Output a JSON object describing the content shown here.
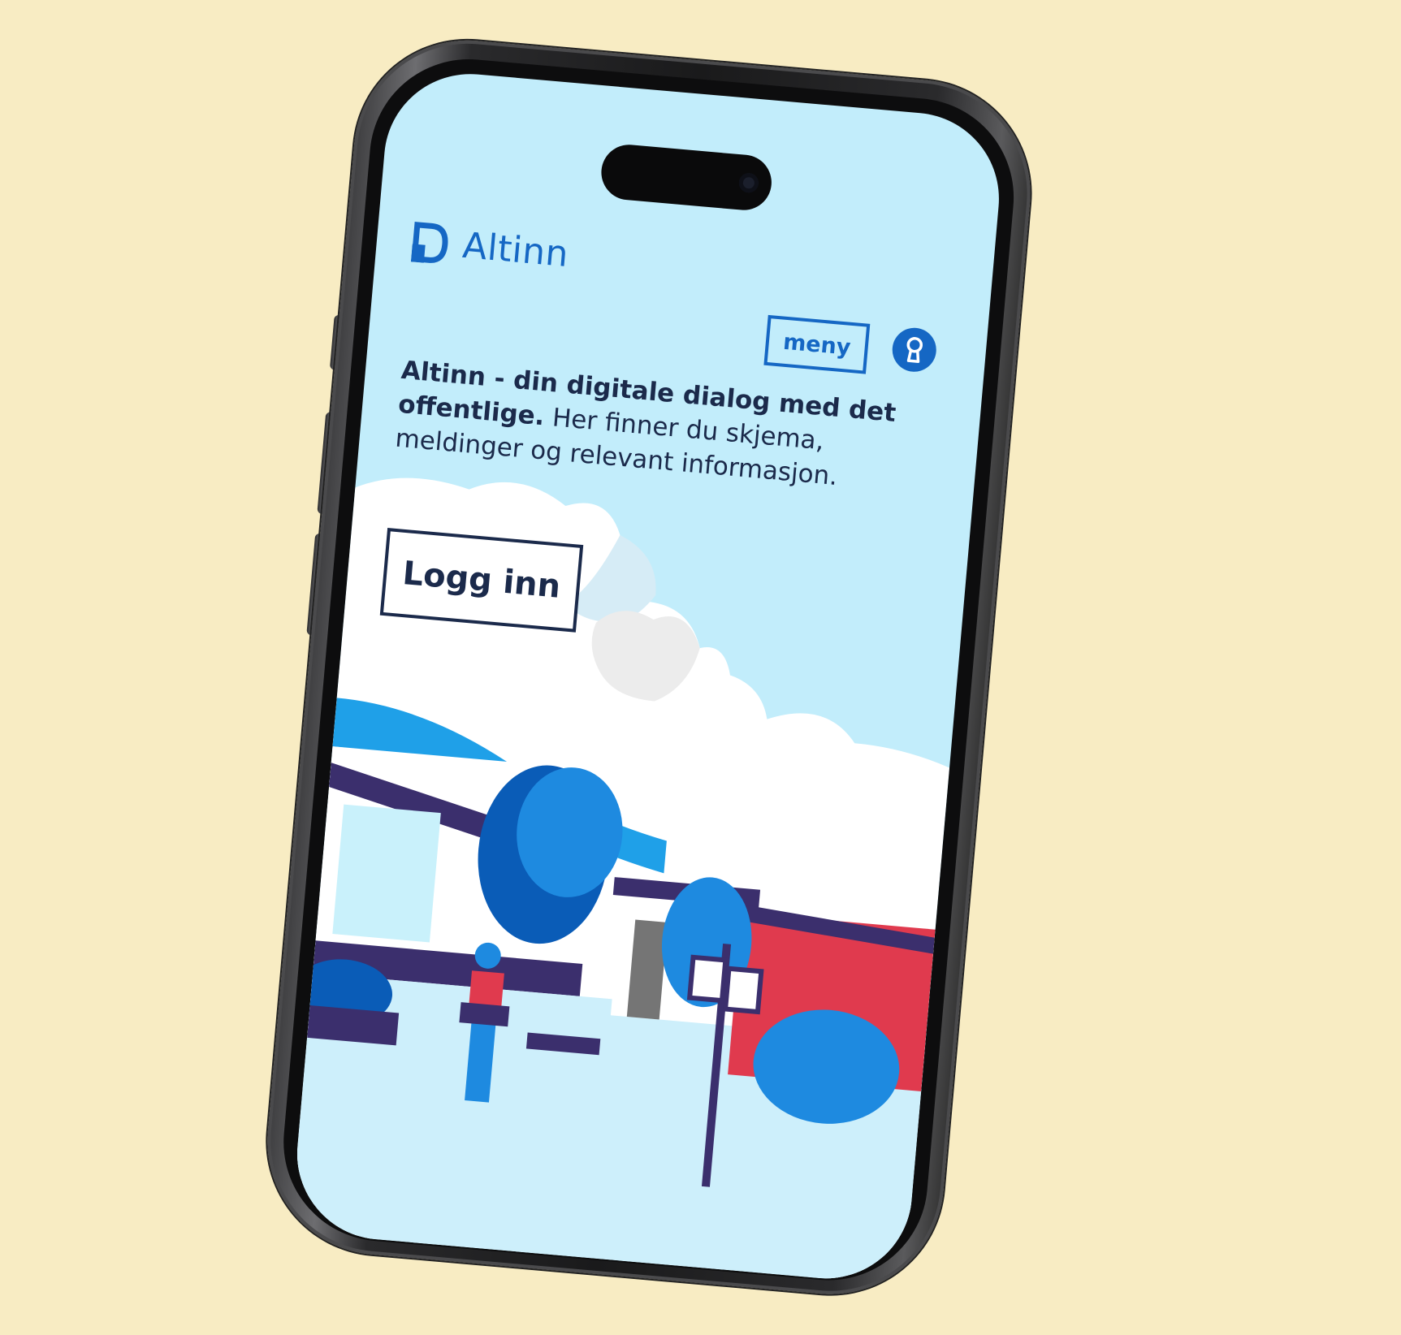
{
  "brand": {
    "name": "Altinn"
  },
  "header": {
    "menu_label": "meny",
    "login_icon": "keyhole-icon"
  },
  "intro": {
    "bold": "Altinn - din digitale dialog med det offentlige.",
    "rest": " Her finner du skjema, meldinger og relevant informasjon."
  },
  "cta": {
    "login_label": "Logg inn"
  },
  "colors": {
    "background": "#f8ecc3",
    "sky": "#c2edfb",
    "brand_blue": "#1567c4",
    "text_dark": "#1b2a4b"
  }
}
